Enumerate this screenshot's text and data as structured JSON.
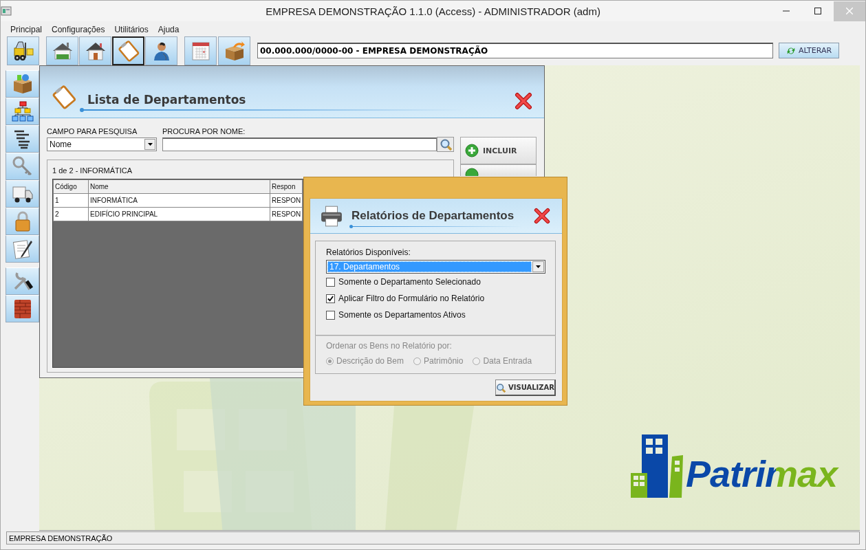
{
  "window": {
    "title": "EMPRESA DEMONSTRAÇÃO 1.1.0 (Access) - ADMINISTRADOR (adm)"
  },
  "menu": [
    "Principal",
    "Configurações",
    "Utilitários",
    "Ajuda"
  ],
  "toolbar": {
    "buttons": [
      {
        "selected": false
      },
      {
        "selected": false
      },
      {
        "selected": false
      },
      {
        "selected": true
      },
      {
        "selected": false
      },
      {
        "selected": false
      },
      {
        "selected": false
      }
    ],
    "company_field": {
      "value": "00.000.000/0000-00 - EMPRESA DEMONSTRAÇÃO"
    },
    "change_button": "ALTERAR"
  },
  "list_window": {
    "title": "Lista de Departamentos",
    "search_field_label": "CAMPO PARA PESQUISA",
    "search_field_value": "Nome",
    "name_search_label": "PROCURA POR NOME:",
    "add_button": "INCLUIR",
    "record_info": "1 de 2 - INFORMÁTICA",
    "table": {
      "columns": [
        "Código",
        "Nome",
        "Respon"
      ],
      "rows": [
        [
          "1",
          "INFORMÁTICA",
          "RESPON"
        ],
        [
          "2",
          "EDIFÍCIO PRINCIPAL",
          "RESPON"
        ]
      ]
    }
  },
  "report_dialog": {
    "title": "Relatórios de Departamentos",
    "reports_label": "Relatórios Disponíveis:",
    "selected_report": "17. Departamentos",
    "options": [
      {
        "label": "Somente o Departamento Selecionado",
        "checked": false
      },
      {
        "label": "Aplicar Filtro do Formulário no Relatório",
        "checked": true
      },
      {
        "label": "Somente os Departamentos Ativos",
        "checked": false
      }
    ],
    "sort": {
      "label": "Ordenar os Bens no Relatório por:",
      "disabled": true,
      "options": [
        {
          "label": "Descrição do Bem",
          "selected": true
        },
        {
          "label": "Patrimônio",
          "selected": false
        },
        {
          "label": "Data Entrada",
          "selected": false
        }
      ]
    },
    "preview_button": "VISUALIZAR"
  },
  "logo": {
    "text": "Patrimax"
  },
  "status_bar": "EMPRESA DEMONSTRAÇÃO"
}
